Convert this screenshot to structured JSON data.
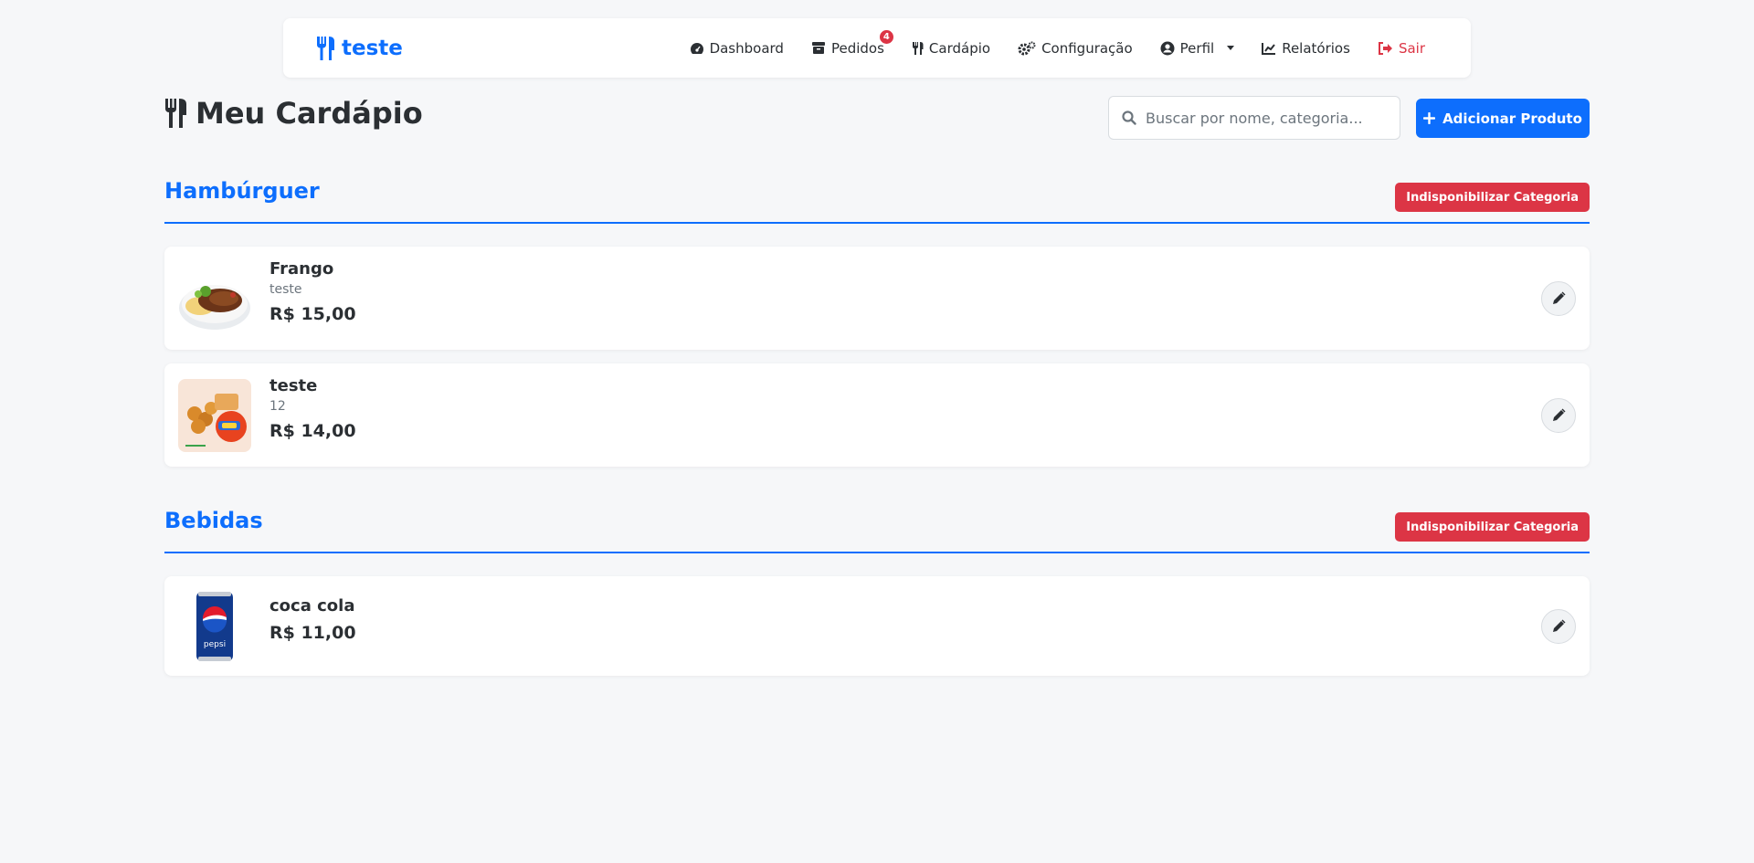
{
  "brand": {
    "name": "teste",
    "icon": "utensils-icon",
    "color": "#0d6efd"
  },
  "nav": {
    "items": [
      {
        "label": "Dashboard",
        "icon": "gauge-icon"
      },
      {
        "label": "Pedidos",
        "icon": "box-icon",
        "badge": "4"
      },
      {
        "label": "Cardápio",
        "icon": "utensils-icon"
      },
      {
        "label": "Configuração",
        "icon": "gears-icon"
      },
      {
        "label": "Perfil",
        "icon": "user-circle-icon"
      },
      {
        "label": "Relatórios",
        "icon": "chart-line-icon"
      },
      {
        "label": "Sair",
        "icon": "sign-out-icon"
      }
    ]
  },
  "page": {
    "title": "Meu Cardápio",
    "search_placeholder": "Buscar por nome, categoria...",
    "add_button": "Adicionar Produto"
  },
  "categories": [
    {
      "title": "Hambúrguer",
      "toggle_label": "Indisponibilizar Categoria",
      "products": [
        {
          "name": "Frango",
          "description": "teste",
          "price": "R$ 15,00",
          "image": "chicken-dish-image"
        },
        {
          "name": "teste",
          "description": "12",
          "price": "R$ 14,00",
          "image": "coxinha-fanta-image"
        }
      ]
    },
    {
      "title": "Bebidas",
      "toggle_label": "Indisponibilizar Categoria",
      "products": [
        {
          "name": "coca cola",
          "price": "R$ 11,00",
          "image": "pepsi-can-image"
        }
      ]
    }
  ],
  "colors": {
    "primary": "#0d6efd",
    "danger": "#dc3545",
    "background": "#f6f7f9"
  }
}
